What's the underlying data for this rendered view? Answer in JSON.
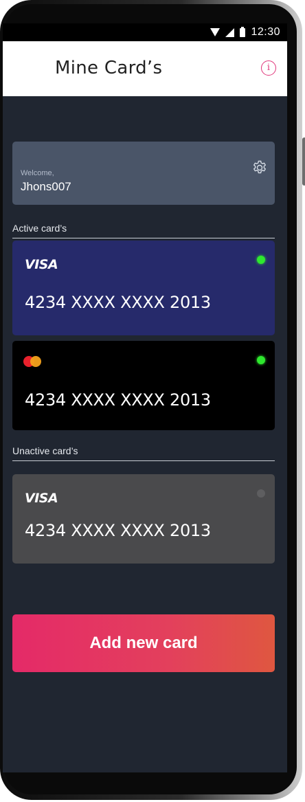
{
  "status_bar": {
    "time": "12:30",
    "icons": [
      "wifi-icon",
      "signal-icon",
      "battery-icon"
    ]
  },
  "header": {
    "title": "Mine Card’s",
    "info_icon": "i"
  },
  "welcome": {
    "label": "Welcome,",
    "username": "Jhons007",
    "icon": "gear-icon"
  },
  "sections": {
    "active": "Active card’s",
    "inactive": "Unactive card’s"
  },
  "cards": [
    {
      "brand": "VISA",
      "number": "4234 XXXX XXXX 2013",
      "status": "active",
      "color": "#262a6b",
      "status_color": "#2ee82e"
    },
    {
      "brand": "mastercard",
      "number": "4234 XXXX XXXX 2013",
      "status": "active",
      "color": "#000000",
      "status_color": "#2ee82e"
    },
    {
      "brand": "VISA",
      "number": "4234 XXXX XXXX 2013",
      "status": "inactive",
      "color": "#4a4a4c",
      "status_color": "#5e5e60"
    }
  ],
  "add_button": {
    "label": "Add new card"
  },
  "colors": {
    "accent": "#e42a68",
    "background": "#202631",
    "welcome_box": "#4a5568"
  }
}
